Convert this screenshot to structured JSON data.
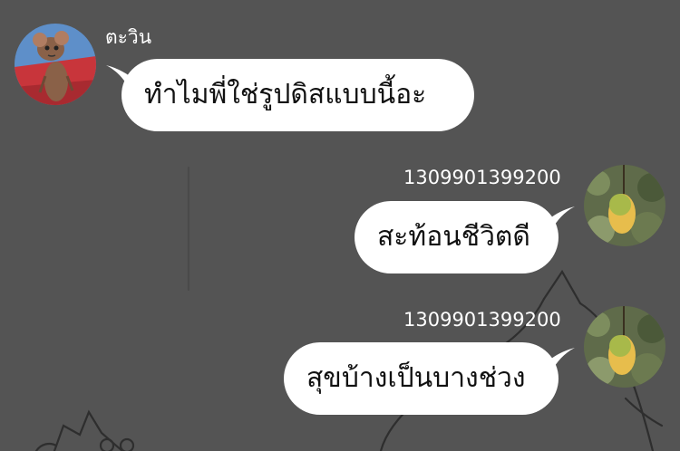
{
  "chat": {
    "messages": [
      {
        "sender": "ตะวิน",
        "text": "ทำไมพี่ใช่รูปดิสแบบนี้อะ",
        "side": "left",
        "avatar_icon": "mouse-cartoon-avatar"
      },
      {
        "sender": "1309901399200",
        "text": "สะท้อนชีวิตดี",
        "side": "right",
        "avatar_icon": "mango-avatar"
      },
      {
        "sender": "1309901399200",
        "text": "สุขบ้างเป็นบางช่วง",
        "side": "right",
        "avatar_icon": "mango-avatar"
      }
    ]
  },
  "colors": {
    "background": "#545454",
    "bubble": "#ffffff",
    "bubble_text": "#111111",
    "name_text": "#ffffff"
  }
}
